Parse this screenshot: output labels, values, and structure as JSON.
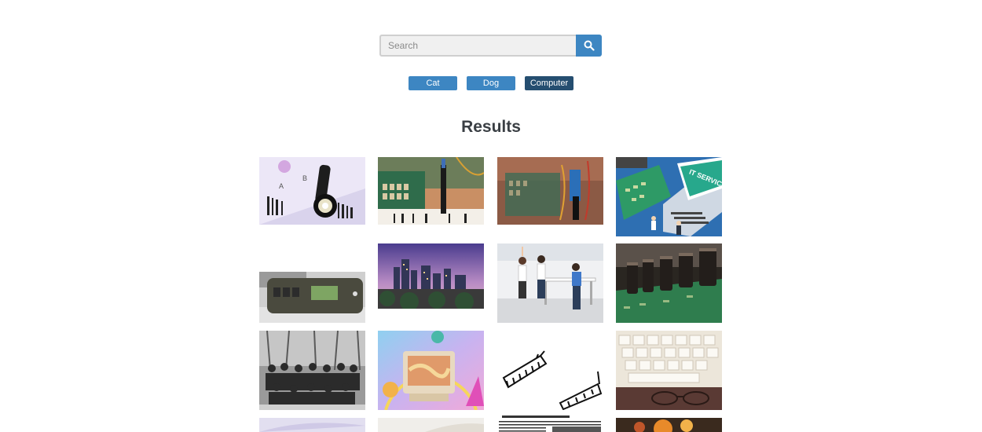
{
  "search": {
    "placeholder": "Search",
    "value": "",
    "button_icon": "search-icon"
  },
  "filters": [
    {
      "label": "Cat",
      "active": false
    },
    {
      "label": "Dog",
      "active": false
    },
    {
      "label": "Computer",
      "active": true
    }
  ],
  "colors": {
    "accent": "#3d86c2",
    "accent_active": "#254e70",
    "title": "#3a3f44"
  },
  "results": {
    "title": "Results",
    "images": [
      {
        "name": "result-image-flashlight-barcode"
      },
      {
        "name": "result-image-circuit-board-probe"
      },
      {
        "name": "result-image-arduino-board"
      },
      {
        "name": "result-image-it-service-illustration"
      },
      {
        "name": "result-image-handheld-device"
      },
      {
        "name": "result-image-city-skyline"
      },
      {
        "name": "result-image-office-yoga"
      },
      {
        "name": "result-image-capacitors-board"
      },
      {
        "name": "result-image-group-photo-bw"
      },
      {
        "name": "result-image-retro-computer-art"
      },
      {
        "name": "result-image-connector-sketch"
      },
      {
        "name": "result-image-keyboard-glasses"
      },
      {
        "name": "result-image-partial-1"
      },
      {
        "name": "result-image-partial-2"
      },
      {
        "name": "result-image-newspaper-text"
      },
      {
        "name": "result-image-partial-4"
      }
    ]
  }
}
